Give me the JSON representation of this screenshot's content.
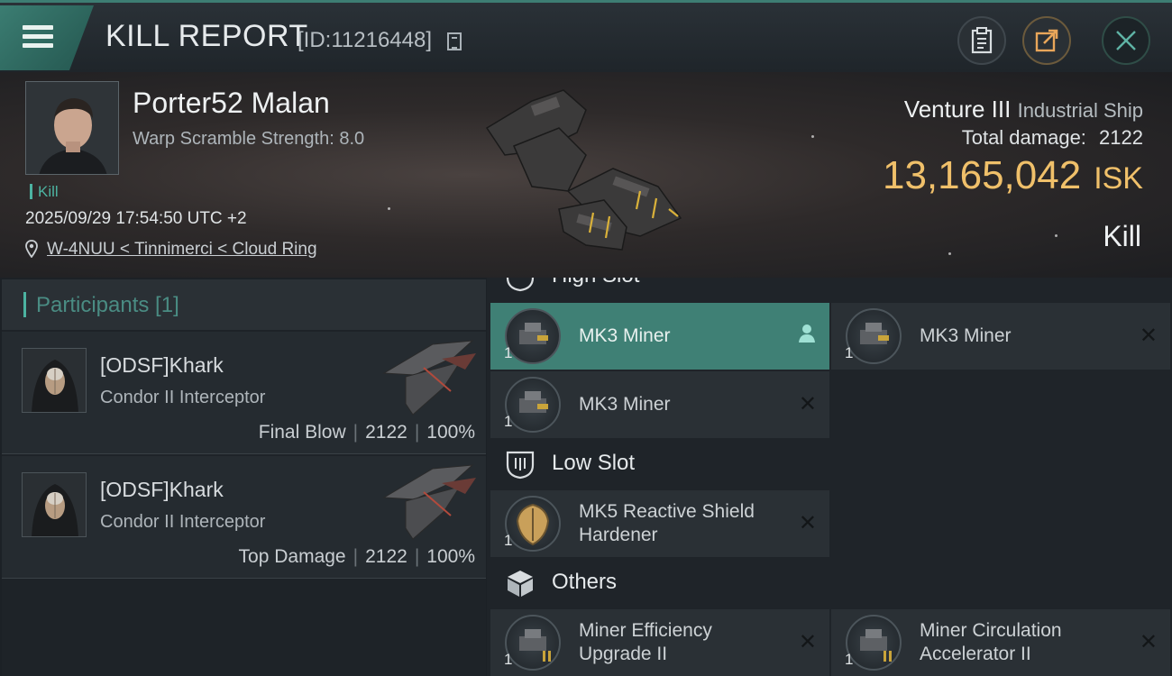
{
  "header": {
    "title": "KILL REPORT",
    "report_id": "[ID:11216448]"
  },
  "victim": {
    "name": "Porter52 Malan",
    "warp_scramble": "Warp Scramble Strength: 8.0",
    "tag": "Kill",
    "datetime": "2025/09/29 17:54:50 UTC +2",
    "location": "W-4NUU < Tinnimerci < Cloud Ring",
    "ship_name": "Venture III",
    "ship_class": "Industrial Ship",
    "total_damage_label": "Total damage:",
    "total_damage_value": "2122",
    "isk_value": "13,165,042",
    "isk_unit": "ISK",
    "result": "Kill"
  },
  "participants": {
    "title": "Participants [1]",
    "list": [
      {
        "name": "[ODSF]Khark",
        "ship": "Condor II Interceptor",
        "role": "Final Blow",
        "damage": "2122",
        "percent": "100%"
      },
      {
        "name": "[ODSF]Khark",
        "ship": "Condor II Interceptor",
        "role": "Top Damage",
        "damage": "2122",
        "percent": "100%"
      }
    ]
  },
  "fitting": {
    "high_slot_label": "High Slot",
    "high_slot": [
      {
        "name": "MK3 Miner",
        "qty": "1"
      },
      {
        "name": "MK3 Miner",
        "qty": "1"
      },
      {
        "name": "MK3 Miner",
        "qty": "1"
      }
    ],
    "low_slot_label": "Low Slot",
    "low_slot": [
      {
        "name_line1": "MK5 Reactive Shield",
        "name_line2": "Hardener",
        "qty": "1"
      }
    ],
    "others_label": "Others",
    "others": [
      {
        "name_line1": "Miner Efficiency",
        "name_line2": "Upgrade II",
        "qty": "1"
      },
      {
        "name_line1": "Miner Circulation",
        "name_line2": "Accelerator II",
        "qty": "1"
      }
    ]
  },
  "colors": {
    "accent": "#3f8075",
    "isk": "#f0c06a",
    "kill_tag": "#4cb3a1"
  }
}
